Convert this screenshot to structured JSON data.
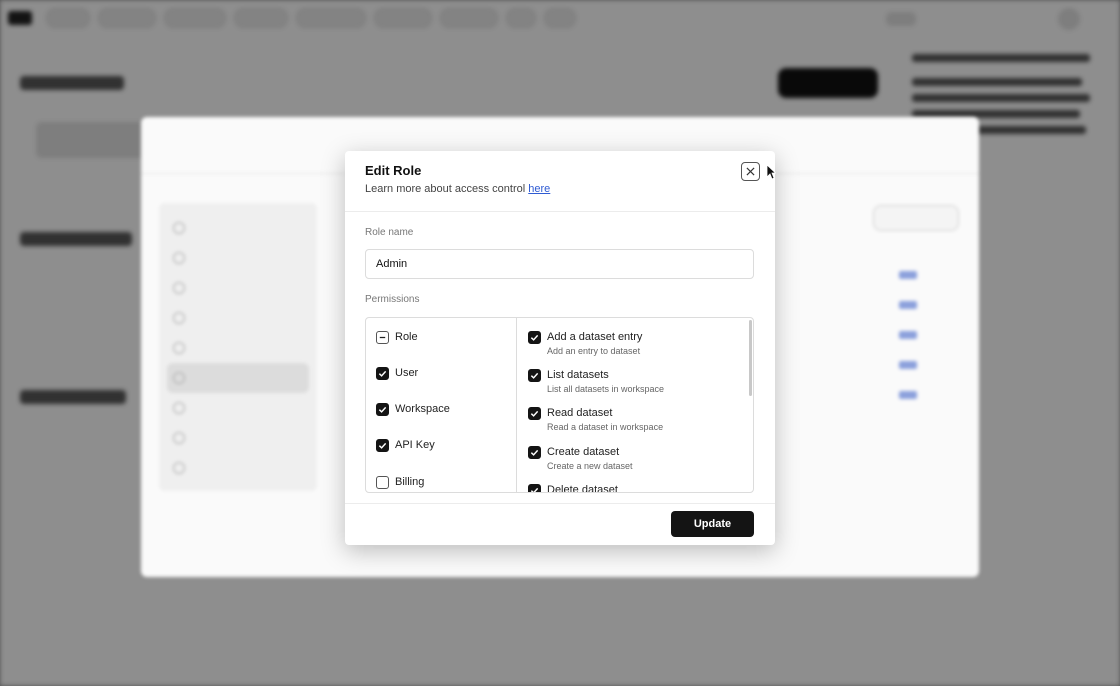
{
  "modal": {
    "title": "Edit Role",
    "subtitle_prefix": "Learn more about access control ",
    "subtitle_link": "here",
    "close_icon": "close-icon",
    "role_name_label": "Role name",
    "role_name_value": "Admin",
    "permissions_label": "Permissions",
    "categories": [
      {
        "label": "Role",
        "state": "partial"
      },
      {
        "label": "User",
        "state": "checked"
      },
      {
        "label": "Workspace",
        "state": "checked"
      },
      {
        "label": "API Key",
        "state": "checked"
      },
      {
        "label": "Billing",
        "state": "unchecked"
      }
    ],
    "permissions": [
      {
        "label": "Add a dataset entry",
        "description": "Add an entry to dataset",
        "checked": true
      },
      {
        "label": "List datasets",
        "description": "List all datasets in workspace",
        "checked": true
      },
      {
        "label": "Read dataset",
        "description": "Read a dataset in workspace",
        "checked": true
      },
      {
        "label": "Create dataset",
        "description": "Create a new dataset",
        "checked": true
      },
      {
        "label": "Delete dataset",
        "description": "",
        "checked": true
      }
    ],
    "update_label": "Update"
  },
  "colors": {
    "accent_link": "#2f5bd3",
    "primary_button": "#141414",
    "overlay": "rgba(0,0,0,0.42)"
  }
}
